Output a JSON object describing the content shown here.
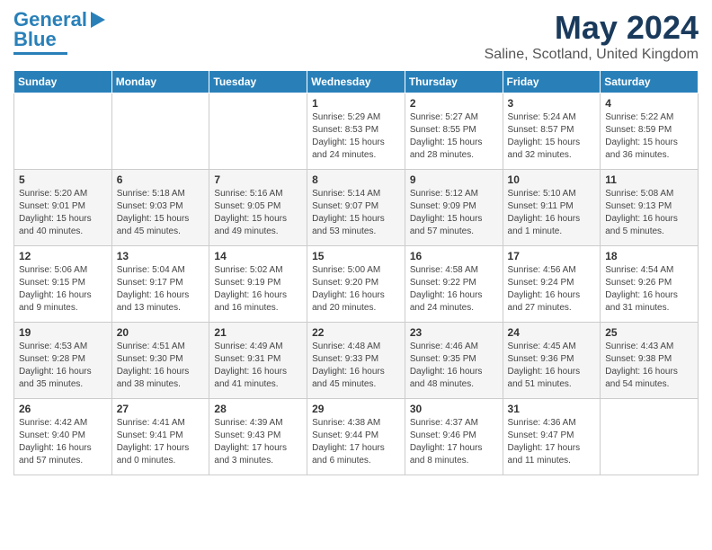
{
  "header": {
    "logo_line1": "General",
    "logo_line2": "Blue",
    "month": "May 2024",
    "location": "Saline, Scotland, United Kingdom"
  },
  "weekdays": [
    "Sunday",
    "Monday",
    "Tuesday",
    "Wednesday",
    "Thursday",
    "Friday",
    "Saturday"
  ],
  "weeks": [
    [
      {
        "day": "",
        "info": ""
      },
      {
        "day": "",
        "info": ""
      },
      {
        "day": "",
        "info": ""
      },
      {
        "day": "1",
        "info": "Sunrise: 5:29 AM\nSunset: 8:53 PM\nDaylight: 15 hours\nand 24 minutes."
      },
      {
        "day": "2",
        "info": "Sunrise: 5:27 AM\nSunset: 8:55 PM\nDaylight: 15 hours\nand 28 minutes."
      },
      {
        "day": "3",
        "info": "Sunrise: 5:24 AM\nSunset: 8:57 PM\nDaylight: 15 hours\nand 32 minutes."
      },
      {
        "day": "4",
        "info": "Sunrise: 5:22 AM\nSunset: 8:59 PM\nDaylight: 15 hours\nand 36 minutes."
      }
    ],
    [
      {
        "day": "5",
        "info": "Sunrise: 5:20 AM\nSunset: 9:01 PM\nDaylight: 15 hours\nand 40 minutes."
      },
      {
        "day": "6",
        "info": "Sunrise: 5:18 AM\nSunset: 9:03 PM\nDaylight: 15 hours\nand 45 minutes."
      },
      {
        "day": "7",
        "info": "Sunrise: 5:16 AM\nSunset: 9:05 PM\nDaylight: 15 hours\nand 49 minutes."
      },
      {
        "day": "8",
        "info": "Sunrise: 5:14 AM\nSunset: 9:07 PM\nDaylight: 15 hours\nand 53 minutes."
      },
      {
        "day": "9",
        "info": "Sunrise: 5:12 AM\nSunset: 9:09 PM\nDaylight: 15 hours\nand 57 minutes."
      },
      {
        "day": "10",
        "info": "Sunrise: 5:10 AM\nSunset: 9:11 PM\nDaylight: 16 hours\nand 1 minute."
      },
      {
        "day": "11",
        "info": "Sunrise: 5:08 AM\nSunset: 9:13 PM\nDaylight: 16 hours\nand 5 minutes."
      }
    ],
    [
      {
        "day": "12",
        "info": "Sunrise: 5:06 AM\nSunset: 9:15 PM\nDaylight: 16 hours\nand 9 minutes."
      },
      {
        "day": "13",
        "info": "Sunrise: 5:04 AM\nSunset: 9:17 PM\nDaylight: 16 hours\nand 13 minutes."
      },
      {
        "day": "14",
        "info": "Sunrise: 5:02 AM\nSunset: 9:19 PM\nDaylight: 16 hours\nand 16 minutes."
      },
      {
        "day": "15",
        "info": "Sunrise: 5:00 AM\nSunset: 9:20 PM\nDaylight: 16 hours\nand 20 minutes."
      },
      {
        "day": "16",
        "info": "Sunrise: 4:58 AM\nSunset: 9:22 PM\nDaylight: 16 hours\nand 24 minutes."
      },
      {
        "day": "17",
        "info": "Sunrise: 4:56 AM\nSunset: 9:24 PM\nDaylight: 16 hours\nand 27 minutes."
      },
      {
        "day": "18",
        "info": "Sunrise: 4:54 AM\nSunset: 9:26 PM\nDaylight: 16 hours\nand 31 minutes."
      }
    ],
    [
      {
        "day": "19",
        "info": "Sunrise: 4:53 AM\nSunset: 9:28 PM\nDaylight: 16 hours\nand 35 minutes."
      },
      {
        "day": "20",
        "info": "Sunrise: 4:51 AM\nSunset: 9:30 PM\nDaylight: 16 hours\nand 38 minutes."
      },
      {
        "day": "21",
        "info": "Sunrise: 4:49 AM\nSunset: 9:31 PM\nDaylight: 16 hours\nand 41 minutes."
      },
      {
        "day": "22",
        "info": "Sunrise: 4:48 AM\nSunset: 9:33 PM\nDaylight: 16 hours\nand 45 minutes."
      },
      {
        "day": "23",
        "info": "Sunrise: 4:46 AM\nSunset: 9:35 PM\nDaylight: 16 hours\nand 48 minutes."
      },
      {
        "day": "24",
        "info": "Sunrise: 4:45 AM\nSunset: 9:36 PM\nDaylight: 16 hours\nand 51 minutes."
      },
      {
        "day": "25",
        "info": "Sunrise: 4:43 AM\nSunset: 9:38 PM\nDaylight: 16 hours\nand 54 minutes."
      }
    ],
    [
      {
        "day": "26",
        "info": "Sunrise: 4:42 AM\nSunset: 9:40 PM\nDaylight: 16 hours\nand 57 minutes."
      },
      {
        "day": "27",
        "info": "Sunrise: 4:41 AM\nSunset: 9:41 PM\nDaylight: 17 hours\nand 0 minutes."
      },
      {
        "day": "28",
        "info": "Sunrise: 4:39 AM\nSunset: 9:43 PM\nDaylight: 17 hours\nand 3 minutes."
      },
      {
        "day": "29",
        "info": "Sunrise: 4:38 AM\nSunset: 9:44 PM\nDaylight: 17 hours\nand 6 minutes."
      },
      {
        "day": "30",
        "info": "Sunrise: 4:37 AM\nSunset: 9:46 PM\nDaylight: 17 hours\nand 8 minutes."
      },
      {
        "day": "31",
        "info": "Sunrise: 4:36 AM\nSunset: 9:47 PM\nDaylight: 17 hours\nand 11 minutes."
      },
      {
        "day": "",
        "info": ""
      }
    ]
  ]
}
